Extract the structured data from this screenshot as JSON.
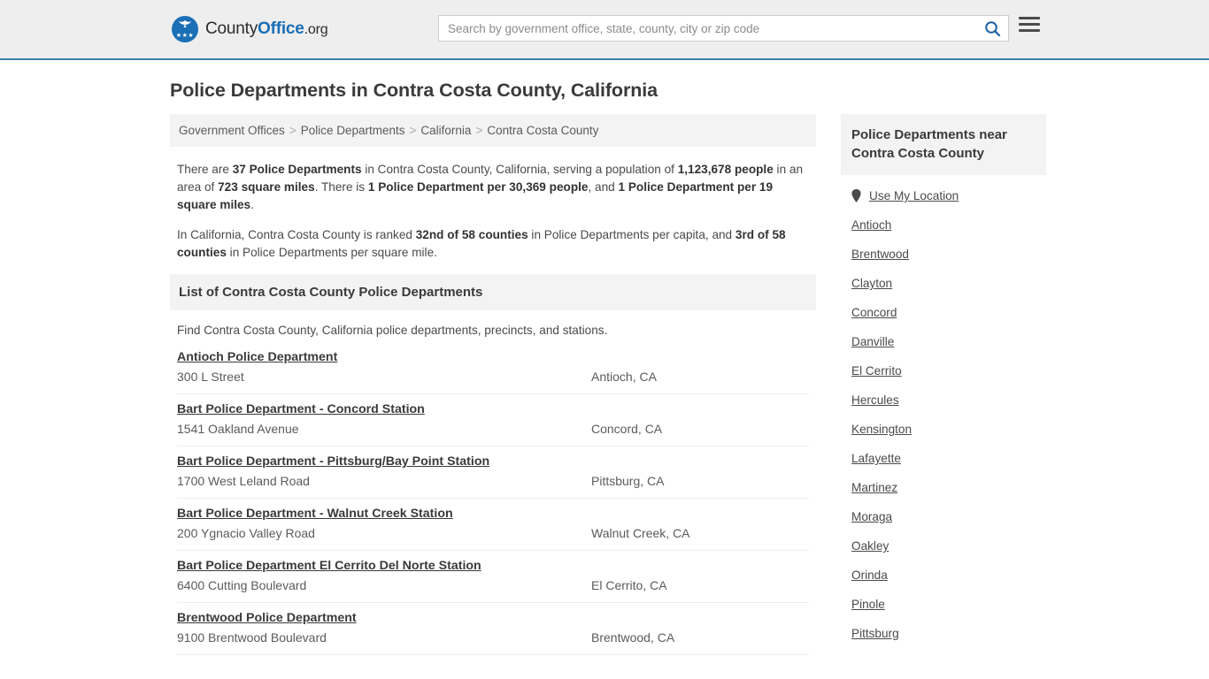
{
  "header": {
    "logo": {
      "part1": "County",
      "part2": "Office",
      "part3": ".org",
      "mark_icon": "eagle-stars-emblem",
      "stars": "★★★"
    },
    "search": {
      "placeholder": "Search by government office, state, county, city or zip code",
      "value": "",
      "search_icon": "search-icon"
    },
    "menu_icon": "hamburger-menu-icon",
    "accent_color": "#3f7faa",
    "background_color": "#eeeeee"
  },
  "page_title": "Police Departments in Contra Costa County, California",
  "breadcrumb": {
    "separator": ">",
    "items": [
      "Government Offices",
      "Police Departments",
      "California",
      "Contra Costa County"
    ]
  },
  "intro": {
    "p1": [
      {
        "t": "There are ",
        "b": false
      },
      {
        "t": "37 Police Departments",
        "b": true
      },
      {
        "t": " in Contra Costa County, California, serving a population of ",
        "b": false
      },
      {
        "t": "1,123,678 people",
        "b": true
      },
      {
        "t": " in an area of ",
        "b": false
      },
      {
        "t": "723 square miles",
        "b": true
      },
      {
        "t": ". There is ",
        "b": false
      },
      {
        "t": "1 Police Department per 30,369 people",
        "b": true
      },
      {
        "t": ", and ",
        "b": false
      },
      {
        "t": "1 Police Department per 19 square miles",
        "b": true
      },
      {
        "t": ".",
        "b": false
      }
    ],
    "p2": [
      {
        "t": "In California, Contra Costa County is ranked ",
        "b": false
      },
      {
        "t": "32nd of 58 counties",
        "b": true
      },
      {
        "t": " in Police Departments per capita, and ",
        "b": false
      },
      {
        "t": "3rd of 58 counties",
        "b": true
      },
      {
        "t": " in Police Departments per square mile.",
        "b": false
      }
    ]
  },
  "list_section": {
    "heading": "List of Contra Costa County Police Departments",
    "subtext": "Find Contra Costa County, California police departments, precincts, and stations.",
    "rows": [
      {
        "name": "Antioch Police Department",
        "address": "300 L Street",
        "city": "Antioch, CA"
      },
      {
        "name": "Bart Police Department - Concord Station",
        "address": "1541 Oakland Avenue",
        "city": "Concord, CA"
      },
      {
        "name": "Bart Police Department - Pittsburg/Bay Point Station",
        "address": "1700 West Leland Road",
        "city": "Pittsburg, CA"
      },
      {
        "name": "Bart Police Department - Walnut Creek Station",
        "address": "200 Ygnacio Valley Road",
        "city": "Walnut Creek, CA"
      },
      {
        "name": "Bart Police Department El Cerrito Del Norte Station",
        "address": "6400 Cutting Boulevard",
        "city": "El Cerrito, CA"
      },
      {
        "name": "Brentwood Police Department",
        "address": "9100 Brentwood Boulevard",
        "city": "Brentwood, CA"
      }
    ]
  },
  "sidebar": {
    "heading": "Police Departments near Contra Costa County",
    "use_my_location": {
      "label": "Use My Location",
      "icon": "map-pin-icon"
    },
    "links": [
      "Antioch",
      "Brentwood",
      "Clayton",
      "Concord",
      "Danville",
      "El Cerrito",
      "Hercules",
      "Kensington",
      "Lafayette",
      "Martinez",
      "Moraga",
      "Oakley",
      "Orinda",
      "Pinole",
      "Pittsburg"
    ]
  }
}
